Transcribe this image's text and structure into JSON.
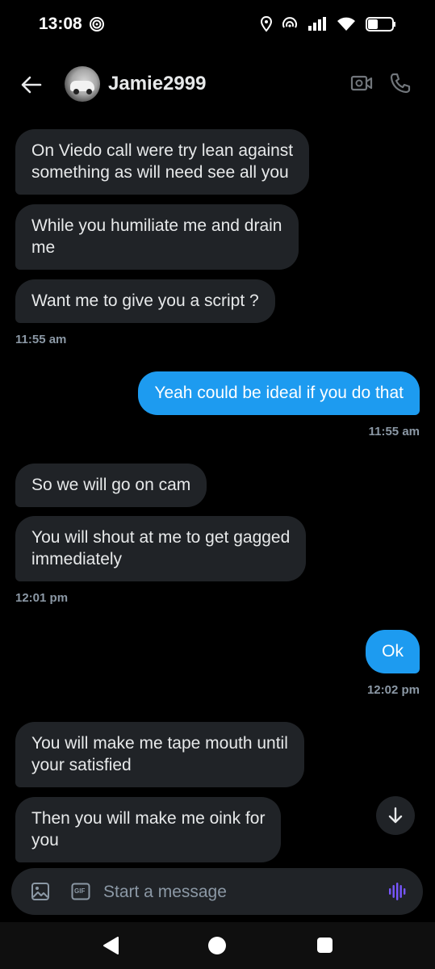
{
  "status_bar": {
    "time": "13:08",
    "icons": [
      "target-icon",
      "location-icon",
      "hotspot-icon",
      "signal-icon",
      "wifi-icon",
      "battery-icon"
    ]
  },
  "header": {
    "back_icon": "arrow-left-icon",
    "contact_name": "Jamie2999",
    "video_icon": "video-call-icon",
    "phone_icon": "phone-icon"
  },
  "messages": [
    {
      "direction": "in",
      "text": [
        "On Viedo call were try lean against",
        "something as will need see all you"
      ]
    },
    {
      "direction": "in",
      "text": [
        "While you humiliate me and drain",
        "me"
      ]
    },
    {
      "direction": "in",
      "text": [
        "Want me to give you a script ?"
      ]
    },
    {
      "direction": "in-ts",
      "text": [
        "11:55 am"
      ]
    },
    {
      "direction": "out",
      "text": [
        "Yeah could be ideal if you do that"
      ]
    },
    {
      "direction": "out-ts",
      "text": [
        "11:55 am"
      ]
    },
    {
      "direction": "in",
      "text": [
        "So we will go on cam"
      ]
    },
    {
      "direction": "in",
      "text": [
        "You will shout at me to get gagged",
        "immediately"
      ]
    },
    {
      "direction": "in-ts",
      "text": [
        "12:01 pm"
      ]
    },
    {
      "direction": "out",
      "text": [
        "Ok"
      ]
    },
    {
      "direction": "out-ts",
      "text": [
        "12:02 pm"
      ]
    },
    {
      "direction": "in",
      "text": [
        "You will make me tape mouth until",
        "your satisfied"
      ]
    },
    {
      "direction": "in",
      "text": [
        "Then you will make me oink for",
        "you"
      ]
    }
  ],
  "composer": {
    "placeholder": "Start a message",
    "gif_label": "GIF",
    "image_icon": "image-icon",
    "voice_icon": "voice-wave-icon"
  },
  "colors": {
    "background": "#000000",
    "incoming_bubble": "#202327",
    "outgoing_bubble": "#1d9bf0",
    "timestamp": "#8b98a5",
    "voice_accent": "#7856ff"
  }
}
